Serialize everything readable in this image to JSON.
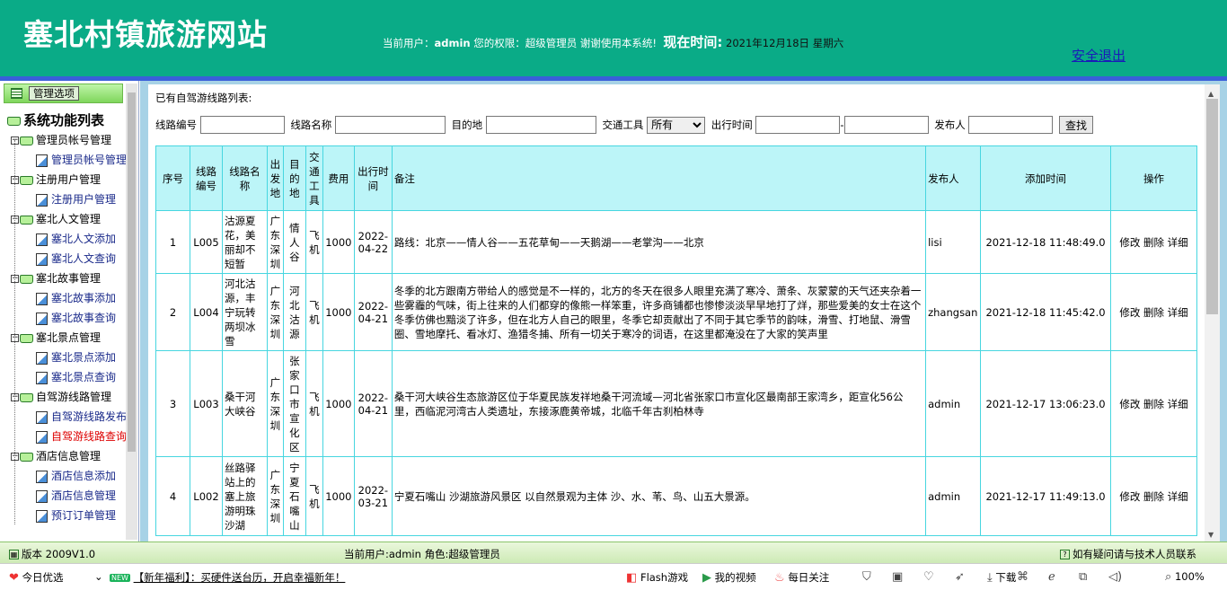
{
  "header": {
    "site_title": "塞北村镇旅游网站",
    "user_prefix": "当前用户：",
    "username": "admin",
    "role_text": " 您的权限：超级管理员 谢谢使用本系统!",
    "time_label": "现在时间:",
    "time_value": "2021年12月18日 星期六",
    "logout": "安全退出"
  },
  "sidebar": {
    "head_button": "管理选项",
    "root": "系统功能列表",
    "groups": [
      {
        "label": "管理员帐号管理",
        "children": [
          "管理员帐号管理"
        ]
      },
      {
        "label": "注册用户管理",
        "children": [
          "注册用户管理"
        ]
      },
      {
        "label": "塞北人文管理",
        "children": [
          "塞北人文添加",
          "塞北人文查询"
        ]
      },
      {
        "label": "塞北故事管理",
        "children": [
          "塞北故事添加",
          "塞北故事查询"
        ]
      },
      {
        "label": "塞北景点管理",
        "children": [
          "塞北景点添加",
          "塞北景点查询"
        ]
      },
      {
        "label": "自驾游线路管理",
        "children": [
          "自驾游线路发布",
          "自驾游线路查询"
        ]
      },
      {
        "label": "酒店信息管理",
        "children": [
          "酒店信息添加",
          "酒店信息管理",
          "预订订单管理"
        ]
      }
    ]
  },
  "main": {
    "list_title": "已有自驾游线路列表:",
    "filter": {
      "route_no": "线路编号",
      "route_name": "线路名称",
      "destination": "目的地",
      "transport": "交通工具",
      "transport_value": "所有",
      "date": "出行时间",
      "dash": "-",
      "publisher": "发布人",
      "search": "查找"
    },
    "columns": [
      "序号",
      "线路编号",
      "线路名称",
      "出发地",
      "目的地",
      "交通工具",
      "费用",
      "出行时间",
      "备注",
      "发布人",
      "添加时间",
      "操作"
    ],
    "rows": [
      {
        "no": "1",
        "code": "L005",
        "name": "沽源夏花，美丽却不短暂",
        "from": "广东深圳",
        "to": "情人谷",
        "transport": "飞机",
        "fee": "1000",
        "date": "2022-04-22",
        "note": "路线：北京——情人谷——五花草甸——天鹅湖——老掌沟——北京",
        "publisher": "lisi",
        "added": "2021-12-18 11:48:49.0",
        "ops": "修改 删除 详细"
      },
      {
        "no": "2",
        "code": "L004",
        "name": "河北沽源，丰宁玩转两坝冰雪",
        "from": "广东深圳",
        "to": "河北沽源",
        "transport": "飞机",
        "fee": "1000",
        "date": "2022-04-21",
        "note": "冬季的北方跟南方带给人的感觉是不一样的，北方的冬天在很多人眼里充满了寒冷、萧条、灰蒙蒙的天气还夹杂着一些雾霾的气味，街上往来的人们都穿的像熊一样笨重，许多商铺都也惨惨淡淡早早地打了烊，那些爱美的女士在这个冬季仿佛也黯淡了许多，但在北方人自己的眼里，冬季它却贡献出了不同于其它季节的韵味，滑雪、打地鼠、滑雪圈、雪地摩托、看冰灯、渔猎冬捕、所有一切关于寒冷的词语，在这里都淹没在了大家的笑声里",
        "publisher": "zhangsan",
        "added": "2021-12-18 11:45:42.0",
        "ops": "修改 删除 详细"
      },
      {
        "no": "3",
        "code": "L003",
        "name": "桑干河大峡谷",
        "from": "广东深圳",
        "to": "张家口市宣化区",
        "transport": "飞机",
        "fee": "1000",
        "date": "2022-04-21",
        "note": "桑干河大峡谷生态旅游区位于华夏民族发祥地桑干河流域—河北省张家口市宣化区最南部王家湾乡，距宣化56公里，西临泥河湾古人类遗址，东接涿鹿黄帝城，北临千年古刹柏林寺",
        "publisher": "admin",
        "added": "2021-12-17 13:06:23.0",
        "ops": "修改 删除 详细"
      },
      {
        "no": "4",
        "code": "L002",
        "name": "丝路驿站上的塞上旅游明珠沙湖",
        "from": "广东深圳",
        "to": "宁夏石嘴山",
        "transport": "飞机",
        "fee": "1000",
        "date": "2022-03-21",
        "note": "宁夏石嘴山 沙湖旅游风景区 以自然景观为主体 沙、水、苇、鸟、山五大景源。",
        "publisher": "admin",
        "added": "2021-12-17 11:49:13.0",
        "ops": "修改 删除 详细"
      }
    ]
  },
  "statusbar": {
    "version": "版本 2009V1.0",
    "current": "当前用户:admin  角色:超级管理员",
    "contact": "如有疑问请与技术人员联系"
  },
  "browserbar": {
    "today": "今日优选",
    "new_badge": "NEW",
    "promo": "【新年福利】：买硬件送台历，开启幸福新年！",
    "flash": "Flash游戏",
    "video": "我的视频",
    "daily": "每日关注",
    "download": "下载",
    "zoom": "100%"
  }
}
